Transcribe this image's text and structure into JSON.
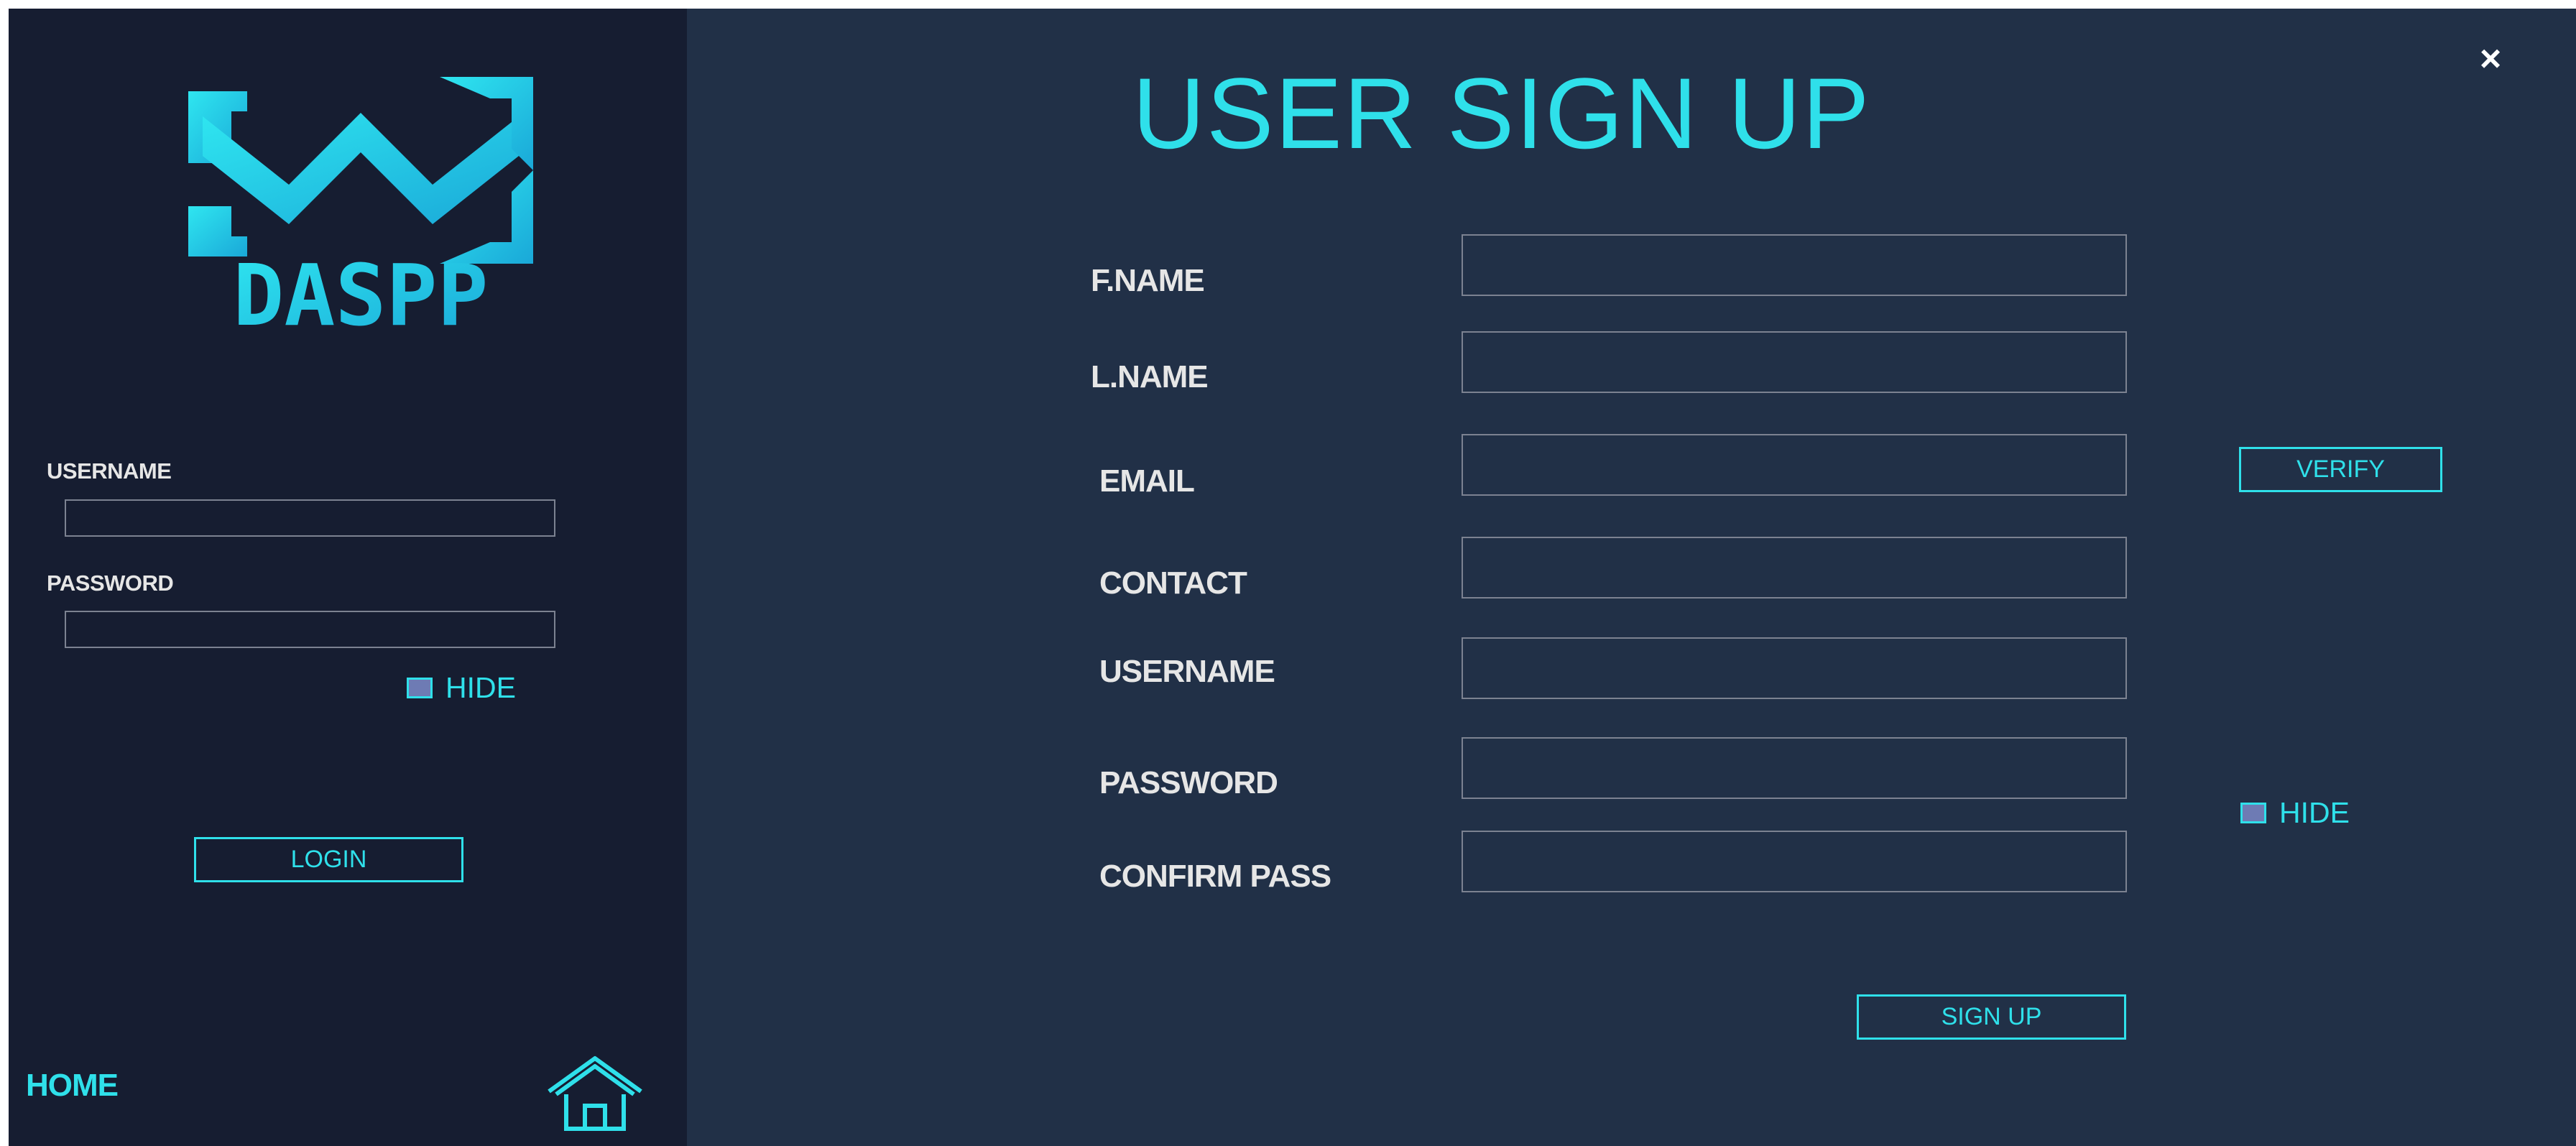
{
  "sidebar": {
    "logo_text": "DASPP",
    "username_label": "USERNAME",
    "username_value": "",
    "password_label": "PASSWORD",
    "password_value": "",
    "hide_label": "HIDE",
    "login_label": "LOGIN",
    "home_label": "HOME",
    "home_icon": "home-icon"
  },
  "signup": {
    "title": "USER SIGN UP",
    "close_glyph": "×",
    "fields": [
      {
        "label": "F.NAME",
        "value": ""
      },
      {
        "label": "L.NAME",
        "value": ""
      },
      {
        "label": "EMAIL",
        "value": ""
      },
      {
        "label": "CONTACT",
        "value": ""
      },
      {
        "label": "USERNAME",
        "value": ""
      },
      {
        "label": "PASSWORD",
        "value": ""
      },
      {
        "label": "CONFIRM PASS",
        "value": ""
      }
    ],
    "verify_label": "VERIFY",
    "hide_label": "HIDE",
    "signup_label": "SIGN UP"
  },
  "colors": {
    "accent": "#2fe0ea",
    "sidebar_bg": "#161d31",
    "main_bg": "#213047",
    "label_text": "#e6e6e6",
    "input_border": "#7c8291",
    "checkbox_fill": "#6e7bb4"
  }
}
